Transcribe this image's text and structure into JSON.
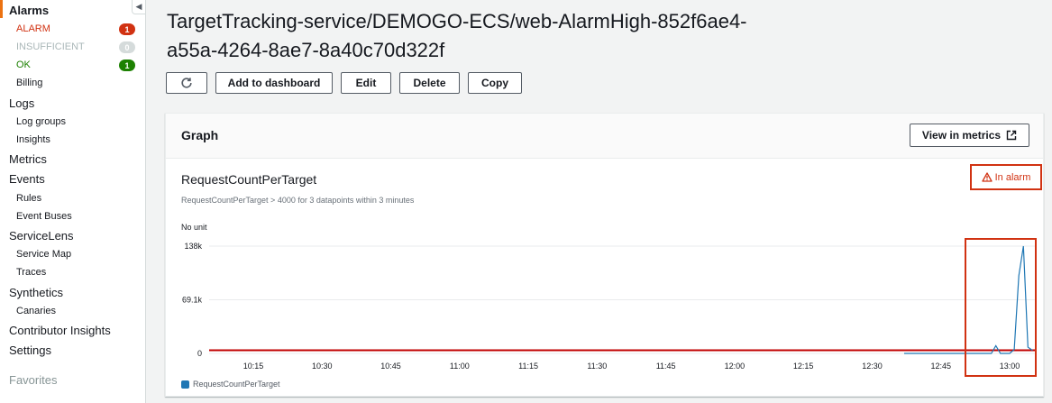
{
  "sidebar": {
    "alarms_label": "Alarms",
    "alarm_states": [
      {
        "label": "ALARM",
        "count": "1"
      },
      {
        "label": "INSUFFICIENT",
        "count": "0"
      },
      {
        "label": "OK",
        "count": "1"
      }
    ],
    "billing": "Billing",
    "logs": "Logs",
    "log_groups": "Log groups",
    "insights": "Insights",
    "metrics": "Metrics",
    "events": "Events",
    "rules": "Rules",
    "event_buses": "Event Buses",
    "servicelens": "ServiceLens",
    "service_map": "Service Map",
    "traces": "Traces",
    "synthetics": "Synthetics",
    "canaries": "Canaries",
    "contributor_insights": "Contributor Insights",
    "settings": "Settings",
    "favorites": "Favorites"
  },
  "page": {
    "title_line1": "TargetTracking-service/DEMOGO-ECS/web-AlarmHigh-852f6ae4-",
    "title_line2": "a55a-4264-8ae7-8a40c70d322f"
  },
  "actions": {
    "add_to_dashboard": "Add to dashboard",
    "edit": "Edit",
    "delete": "Delete",
    "copy": "Copy"
  },
  "graph_panel": {
    "title": "Graph",
    "view_in_metrics": "View in metrics",
    "metric_name": "RequestCountPerTarget",
    "condition": "RequestCountPerTarget > 4000 for 3 datapoints within 3 minutes",
    "state": "In alarm",
    "unit": "No unit"
  },
  "colors": {
    "alarm_red": "#d13212",
    "ok_green": "#1d8102",
    "series_blue": "#1f77b4",
    "threshold_red": "#c00000"
  },
  "chart_data": {
    "type": "line",
    "ylabel": "No unit",
    "y_ticks": [
      "0",
      "69.1k",
      "138k"
    ],
    "ylim": [
      0,
      138000
    ],
    "x_ticks": [
      "10:15",
      "10:30",
      "10:45",
      "11:00",
      "11:15",
      "11:30",
      "11:45",
      "12:00",
      "12:15",
      "12:30",
      "12:45",
      "13:00"
    ],
    "threshold": 4000,
    "series": [
      {
        "name": "RequestCountPerTarget",
        "points": [
          [
            "12:37",
            0
          ],
          [
            "12:47",
            0
          ],
          [
            "12:54",
            0
          ],
          [
            "12:56",
            0
          ],
          [
            "12:57",
            10000
          ],
          [
            "12:58",
            0
          ],
          [
            "12:59",
            0
          ],
          [
            "13:00",
            0
          ],
          [
            "13:01",
            5000
          ],
          [
            "13:02",
            100000
          ],
          [
            "13:03",
            138000
          ],
          [
            "13:04",
            8000
          ],
          [
            "13:05",
            4000
          ]
        ]
      }
    ]
  }
}
